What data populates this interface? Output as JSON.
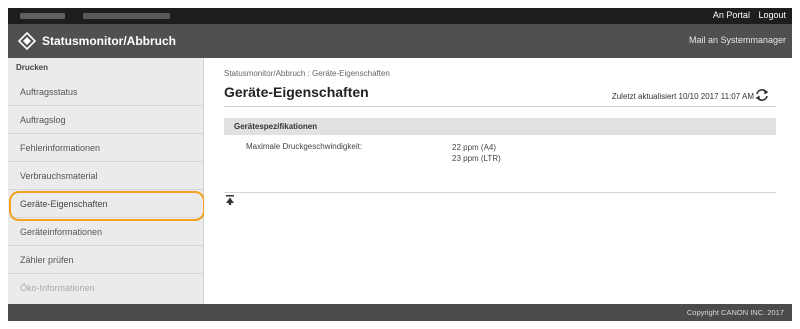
{
  "header": {
    "links": [
      "An Portal",
      "Logout"
    ]
  },
  "titlebar": {
    "title": "Statusmonitor/Abbruch",
    "mail": "Mail an Systemmanager"
  },
  "sidebar": {
    "section": "Drucken",
    "items": [
      {
        "label": "Auftragsstatus",
        "state": "normal"
      },
      {
        "label": "Auftragslog",
        "state": "normal"
      },
      {
        "label": "Fehlerinformationen",
        "state": "normal"
      },
      {
        "label": "Verbrauchsmaterial",
        "state": "normal"
      },
      {
        "label": "Geräte-Eigenschaften",
        "state": "active"
      },
      {
        "label": "Geräteinformationen",
        "state": "normal"
      },
      {
        "label": "Zähler prüfen",
        "state": "normal"
      },
      {
        "label": "Öko-Informationen",
        "state": "disabled"
      }
    ]
  },
  "main": {
    "breadcrumb": "Statusmonitor/Abbruch : Geräte-Eigenschaften",
    "title": "Geräte-Eigenschaften",
    "updated": "Zuletzt aktualisiert 10/10 2017 11:07 AM",
    "spec_section": "Gerätespezifikationen",
    "spec_label": "Maximale Druckgeschwindigkeit:",
    "spec_values": [
      "22 ppm (A4)",
      "23 ppm (LTR)"
    ]
  },
  "footer": {
    "copyright": "Copyright CANON INC. 2017"
  },
  "colors": {
    "highlight": "#f1a31e",
    "titlebar": "#505050",
    "topbar": "#1e1e1e"
  },
  "icons": [
    "logo-diamond-icon",
    "refresh-icon",
    "back-to-top-icon"
  ]
}
